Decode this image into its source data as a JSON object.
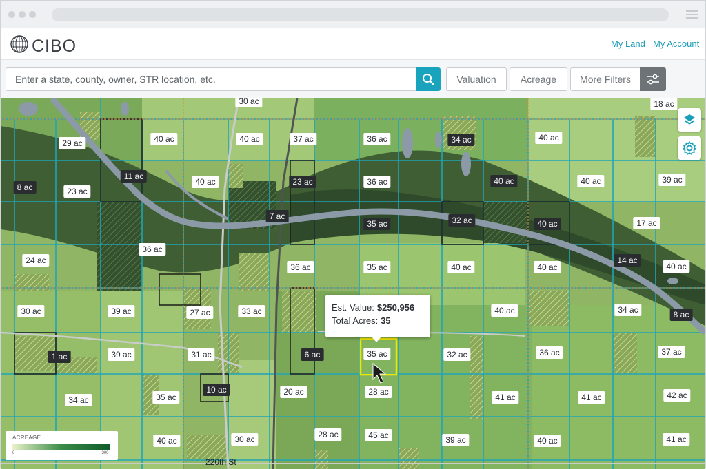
{
  "header": {
    "logo_text": "CIBO",
    "nav": [
      {
        "label": "My Land"
      },
      {
        "label": "My Account"
      }
    ]
  },
  "toolbar": {
    "search_placeholder": "Enter a state, county, owner, STR location, etc.",
    "filters": [
      {
        "label": "Valuation"
      },
      {
        "label": "Acreage"
      },
      {
        "label": "More Filters"
      }
    ],
    "icons": {
      "search": "search-icon",
      "sliders": "sliders-icon"
    }
  },
  "map": {
    "controls": [
      {
        "icon": "layers-icon"
      },
      {
        "icon": "gear-icon"
      }
    ],
    "road_label": "220th St",
    "parcels": [
      {
        "label": "30 ac",
        "style": "light"
      },
      {
        "label": "18 ac",
        "style": "light"
      },
      {
        "label": "29 ac",
        "style": "light"
      },
      {
        "label": "40 ac",
        "style": "light"
      },
      {
        "label": "40 ac",
        "style": "light"
      },
      {
        "label": "37 ac",
        "style": "light"
      },
      {
        "label": "36 ac",
        "style": "light"
      },
      {
        "label": "34 ac",
        "style": "dark"
      },
      {
        "label": "40 ac",
        "style": "light"
      },
      {
        "label": "11 ac",
        "style": "dark"
      },
      {
        "label": "8 ac",
        "style": "dark"
      },
      {
        "label": "23 ac",
        "style": "light"
      },
      {
        "label": "40 ac",
        "style": "light"
      },
      {
        "label": "23 ac",
        "style": "dark"
      },
      {
        "label": "36 ac",
        "style": "light"
      },
      {
        "label": "40 ac",
        "style": "dark"
      },
      {
        "label": "40 ac",
        "style": "light"
      },
      {
        "label": "39 ac",
        "style": "light"
      },
      {
        "label": "7 ac",
        "style": "dark"
      },
      {
        "label": "35 ac",
        "style": "dark"
      },
      {
        "label": "32 ac",
        "style": "dark"
      },
      {
        "label": "40 ac",
        "style": "dark"
      },
      {
        "label": "17 ac",
        "style": "light"
      },
      {
        "label": "36 ac",
        "style": "light"
      },
      {
        "label": "24 ac",
        "style": "light"
      },
      {
        "label": "36 ac",
        "style": "light"
      },
      {
        "label": "35 ac",
        "style": "light"
      },
      {
        "label": "40 ac",
        "style": "light"
      },
      {
        "label": "40 ac",
        "style": "light"
      },
      {
        "label": "14 ac",
        "style": "dark"
      },
      {
        "label": "40 ac",
        "style": "light"
      },
      {
        "label": "30 ac",
        "style": "light"
      },
      {
        "label": "39 ac",
        "style": "light"
      },
      {
        "label": "27 ac",
        "style": "light"
      },
      {
        "label": "33 ac",
        "style": "light"
      },
      {
        "label": "40 ac",
        "style": "light"
      },
      {
        "label": "34 ac",
        "style": "light"
      },
      {
        "label": "8 ac",
        "style": "dark"
      },
      {
        "label": "1 ac",
        "style": "dark"
      },
      {
        "label": "39 ac",
        "style": "light"
      },
      {
        "label": "31 ac",
        "style": "light"
      },
      {
        "label": "6 ac",
        "style": "dark"
      },
      {
        "label": "35 ac",
        "style": "light"
      },
      {
        "label": "32 ac",
        "style": "light"
      },
      {
        "label": "36 ac",
        "style": "light"
      },
      {
        "label": "37 ac",
        "style": "light"
      },
      {
        "label": "10 ac",
        "style": "dark"
      },
      {
        "label": "20 ac",
        "style": "light"
      },
      {
        "label": "28 ac",
        "style": "light"
      },
      {
        "label": "34 ac",
        "style": "light"
      },
      {
        "label": "35 ac",
        "style": "light"
      },
      {
        "label": "41 ac",
        "style": "light"
      },
      {
        "label": "41 ac",
        "style": "light"
      },
      {
        "label": "42 ac",
        "style": "light"
      },
      {
        "label": "28 ac",
        "style": "light"
      },
      {
        "label": "45 ac",
        "style": "light"
      },
      {
        "label": "40 ac",
        "style": "light"
      },
      {
        "label": "30 ac",
        "style": "light"
      },
      {
        "label": "39 ac",
        "style": "light"
      },
      {
        "label": "40 ac",
        "style": "light"
      },
      {
        "label": "41 ac",
        "style": "light"
      }
    ],
    "tooltip": {
      "value_label": "Est. Value:",
      "value": "$250,956",
      "acres_label": "Total Acres:",
      "acres": "35"
    },
    "legend": {
      "title": "ACREAGE",
      "min": "0",
      "max": "300+"
    }
  }
}
